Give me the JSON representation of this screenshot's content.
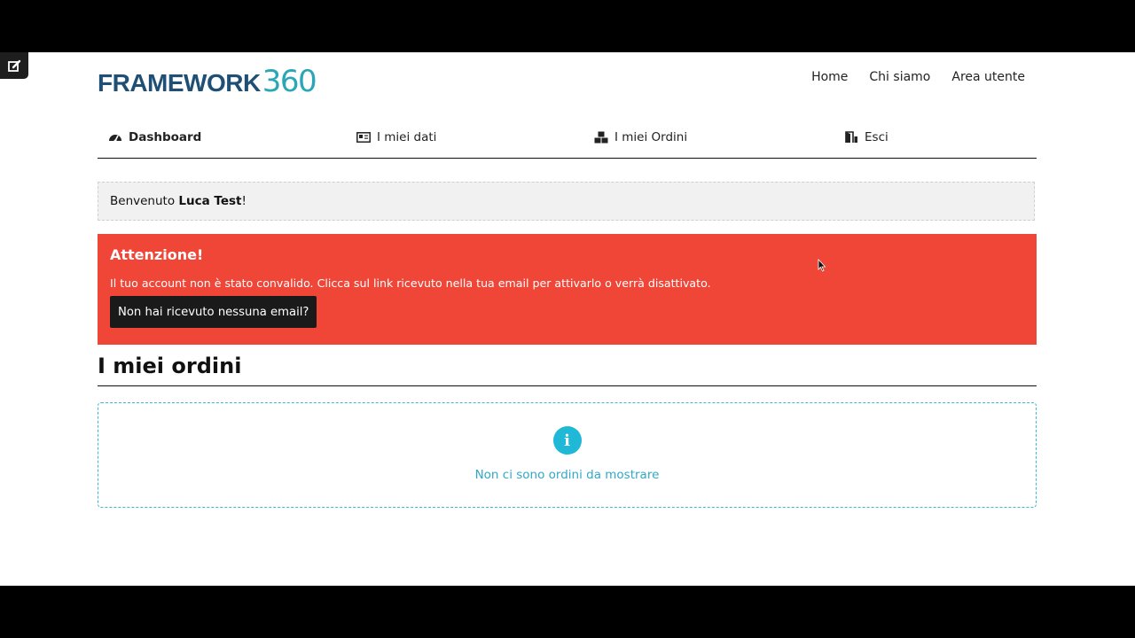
{
  "brand": {
    "word": "FRAMEWORK",
    "number": "360"
  },
  "top_nav": [
    "Home",
    "Chi siamo",
    "Area utente"
  ],
  "tabs": [
    {
      "label": "Dashboard",
      "icon": "dashboard-icon",
      "active": true
    },
    {
      "label": "I miei dati",
      "icon": "id-card-icon",
      "active": false
    },
    {
      "label": "I miei Ordini",
      "icon": "boxes-icon",
      "active": false
    },
    {
      "label": "Esci",
      "icon": "door-exit-icon",
      "active": false
    }
  ],
  "welcome": {
    "prefix": "Benvenuto ",
    "name": "Luca Test",
    "suffix": "!"
  },
  "alert": {
    "title": "Attenzione!",
    "message": "Il tuo account non è stato convalido. Clicca sul link ricevuto nella tua email per attivarlo o verrà disattivato.",
    "button": "Non hai ricevuto nessuna email?"
  },
  "orders": {
    "heading": "I miei ordini",
    "empty_message": "Non ci sono ordini da mostrare",
    "empty_icon": "info-circle-icon"
  },
  "colors": {
    "alert_bg": "#ef4638",
    "info_accent": "#1fb8d6",
    "brand_dark": "#1f4f74",
    "brand_teal": "#2aa6b6"
  }
}
